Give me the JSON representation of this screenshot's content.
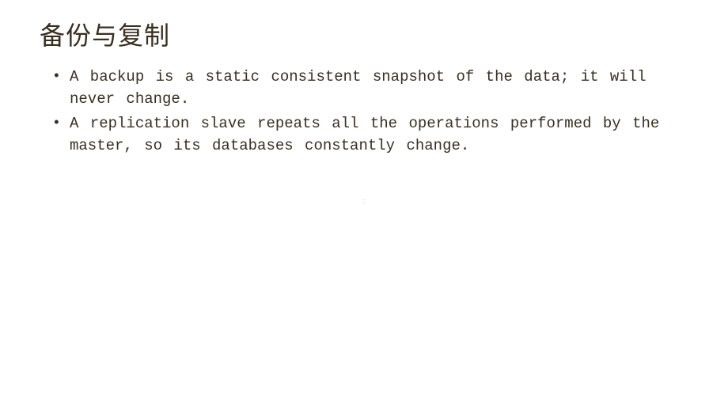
{
  "slide": {
    "title": "备份与复制",
    "bullets": [
      "A backup is a static consistent snapshot of the data; it will never change.",
      "A replication slave repeats all the operations performed by the master, so its databases constantly change."
    ],
    "center_mark": "::"
  }
}
